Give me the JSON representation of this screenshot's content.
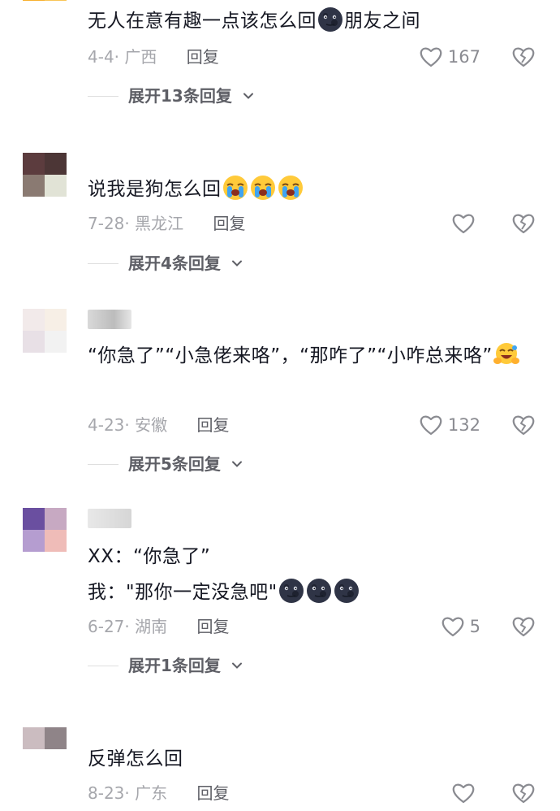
{
  "comments": [
    {
      "avatar_colors": [
        "#f7b02f",
        "#f9c557",
        "#ffffff",
        "#ffffff"
      ],
      "text_parts": [
        "无人在意有趣一点该怎么回",
        "朋友之间"
      ],
      "date": "4-4",
      "region": "广西",
      "reply_label": "回复",
      "likes": "167",
      "expand_label": "展开13条回复",
      "emoji": "dark-moon-face"
    },
    {
      "avatar_colors": [
        "#5c3c3e",
        "#4c3636",
        "#8a7a72",
        "#e1e3d6"
      ],
      "text": "说我是狗怎么回",
      "emoji_count": 3,
      "emoji": "crying-face",
      "date": "7-28",
      "region": "黑龙江",
      "reply_label": "回复",
      "likes": "",
      "expand_label": "展开4条回复"
    },
    {
      "avatar_colors": [
        "#f2eaea",
        "#f7efe6",
        "#e8e0e6",
        "#f2f2f2"
      ],
      "text": "“你急了”“小急佬来咯”，“那咋了”“小咋总来咯”",
      "emoji": "hugging-laugh-face",
      "date": "4-23",
      "region": "安徽",
      "reply_label": "回复",
      "likes": "132",
      "expand_label": "展开5条回复"
    },
    {
      "avatar_colors": [
        "#6a4fa0",
        "#c7a9c2",
        "#b59dd0",
        "#efbcb8"
      ],
      "text_line1": "XX：“你急了”",
      "text_line2": "我：\"那你一定没急吧\"",
      "emoji_count": 3,
      "emoji": "dark-moon-face",
      "date": "6-27",
      "region": "湖南",
      "reply_label": "回复",
      "likes": "5",
      "expand_label": "展开1条回复"
    },
    {
      "avatar_colors": [
        "#cbbcc0",
        "#8f8488",
        "#ffffff",
        "#ffffff"
      ],
      "text": "反弹怎么回",
      "date": "8-23",
      "region": "广东",
      "reply_label": "回复",
      "likes": ""
    }
  ],
  "icons": {
    "like": "heart-outline-icon",
    "dislike": "broken-heart-icon",
    "expand": "chevron-down-icon"
  },
  "colors": {
    "text": "#161823",
    "meta": "#a6a7ac",
    "action": "#5e5f66"
  }
}
